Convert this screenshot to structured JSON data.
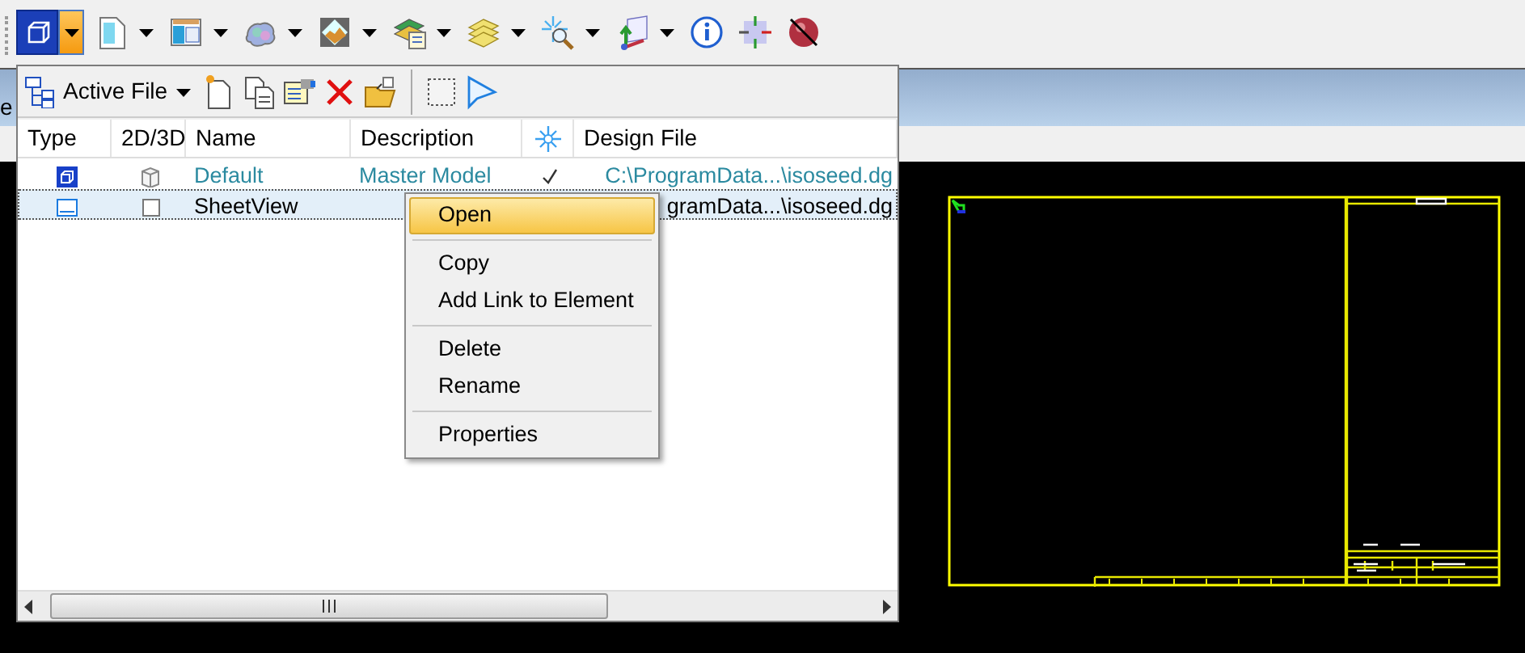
{
  "toolbar": {
    "buttons": [
      {
        "selected": true,
        "dropdown": true
      },
      {
        "selected": false,
        "dropdown": true
      },
      {
        "selected": false,
        "dropdown": true
      },
      {
        "selected": false,
        "dropdown": true
      },
      {
        "selected": false,
        "dropdown": true
      },
      {
        "selected": false,
        "dropdown": true
      },
      {
        "selected": false,
        "dropdown": true
      },
      {
        "selected": false,
        "dropdown": true
      },
      {
        "selected": false,
        "dropdown": true
      },
      {
        "selected": false,
        "dropdown": false
      },
      {
        "selected": false,
        "dropdown": false
      },
      {
        "selected": false,
        "dropdown": false
      }
    ]
  },
  "background_title": "e",
  "models_panel": {
    "file_selector": "Active File",
    "columns": [
      {
        "kind": "text",
        "label": "Type"
      },
      {
        "kind": "text",
        "label": "2D/3D"
      },
      {
        "kind": "text",
        "label": "Name"
      },
      {
        "kind": "text",
        "label": "Description"
      },
      {
        "kind": "icon"
      },
      {
        "kind": "text",
        "label": "Design File"
      }
    ],
    "rows": [
      {
        "kind": "design",
        "is_3d": true,
        "name": "Default",
        "description": "Master Model",
        "marked": true,
        "design_file": "C:\\ProgramData...\\isoseed.dg",
        "active": true,
        "selected": false
      },
      {
        "kind": "sheet",
        "is_3d": false,
        "name": "SheetView",
        "design_file": "gramData...\\isoseed.dg",
        "active": false,
        "selected": true
      }
    ]
  },
  "context_menu": {
    "items": [
      {
        "kind": "item",
        "label": "Open",
        "selected": true
      },
      {
        "kind": "separator"
      },
      {
        "kind": "item",
        "label": "Copy",
        "selected": false
      },
      {
        "kind": "item",
        "label": "Add Link to Element",
        "selected": false
      },
      {
        "kind": "separator"
      },
      {
        "kind": "item",
        "label": "Delete",
        "selected": false
      },
      {
        "kind": "item",
        "label": "Rename",
        "selected": false
      },
      {
        "kind": "separator"
      },
      {
        "kind": "item",
        "label": "Properties",
        "selected": false
      }
    ]
  }
}
